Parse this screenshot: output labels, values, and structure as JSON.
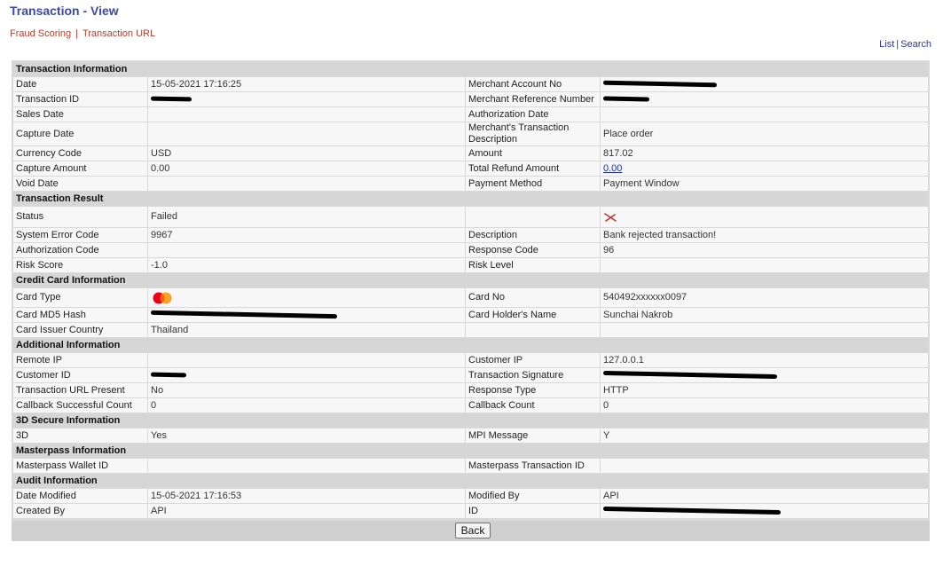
{
  "page": {
    "title": "Transaction - View"
  },
  "nav": {
    "fraud_scoring": "Fraud Scoring",
    "separator": "|",
    "transaction_url": "Transaction URL"
  },
  "right_nav": {
    "list": "List",
    "separator": "|",
    "search": "Search"
  },
  "sections": {
    "transaction_information": {
      "title": "Transaction Information",
      "date_label": "Date",
      "date": "15-05-2021 17:16:25",
      "merchant_account_no_label": "Merchant Account No",
      "merchant_account_no": "",
      "transaction_id_label": "Transaction ID",
      "transaction_id": "",
      "merchant_reference_number_label": "Merchant Reference Number",
      "merchant_reference_number": "",
      "sales_date_label": "Sales Date",
      "sales_date": "",
      "authorization_date_label": "Authorization Date",
      "authorization_date": "",
      "capture_date_label": "Capture Date",
      "capture_date": "",
      "merchant_transaction_description_label": "Merchant's Transaction Description",
      "merchant_transaction_description": "Place order",
      "currency_code_label": "Currency Code",
      "currency_code": "USD",
      "amount_label": "Amount",
      "amount": "817.02",
      "capture_amount_label": "Capture Amount",
      "capture_amount": "0.00",
      "total_refund_amount_label": "Total Refund Amount",
      "total_refund_amount": "0.00",
      "void_date_label": "Void Date",
      "void_date": "",
      "payment_method_label": "Payment Method",
      "payment_method": "Payment Window"
    },
    "transaction_result": {
      "title": "Transaction Result",
      "status_label": "Status",
      "status": "Failed",
      "status_icon": "failed-x-icon",
      "system_error_code_label": "System Error Code",
      "system_error_code": "9967",
      "description_label": "Description",
      "description": "Bank rejected transaction!",
      "authorization_code_label": "Authorization Code",
      "authorization_code": "",
      "response_code_label": "Response Code",
      "response_code": "96",
      "risk_score_label": "Risk Score",
      "risk_score": "-1.0",
      "risk_level_label": "Risk Level",
      "risk_level": ""
    },
    "credit_card_information": {
      "title": "Credit Card Information",
      "card_type_label": "Card Type",
      "card_type_icon": "mastercard-icon",
      "card_no_label": "Card No",
      "card_no": "540492xxxxxx0097",
      "card_md5_hash_label": "Card MD5 Hash",
      "card_md5_hash": "",
      "card_holder_name_label": "Card Holder's Name",
      "card_holder_name": "Sunchai Nakrob",
      "card_issuer_country_label": "Card Issuer Country",
      "card_issuer_country": "Thailand"
    },
    "additional_information": {
      "title": "Additional Information",
      "remote_ip_label": "Remote IP",
      "remote_ip": "",
      "customer_ip_label": "Customer IP",
      "customer_ip": "127.0.0.1",
      "customer_id_label": "Customer ID",
      "customer_id": "",
      "transaction_signature_label": "Transaction Signature",
      "transaction_signature": "",
      "transaction_url_present_label": "Transaction URL Present",
      "transaction_url_present": "No",
      "response_type_label": "Response Type",
      "response_type": "HTTP",
      "callback_successful_count_label": "Callback Successful Count",
      "callback_successful_count": "0",
      "callback_count_label": "Callback Count",
      "callback_count": "0"
    },
    "secure_3d_information": {
      "title": "3D Secure Information",
      "three_d_label": "3D",
      "three_d": "Yes",
      "mpi_message_label": "MPI Message",
      "mpi_message": "Y"
    },
    "masterpass_information": {
      "title": "Masterpass Information",
      "masterpass_wallet_id_label": "Masterpass Wallet ID",
      "masterpass_wallet_id": "",
      "masterpass_transaction_id_label": "Masterpass Transaction ID",
      "masterpass_transaction_id": ""
    },
    "audit_information": {
      "title": "Audit Information",
      "date_modified_label": "Date Modified",
      "date_modified": "15-05-2021 17:16:53",
      "modified_by_label": "Modified By",
      "modified_by": "API",
      "created_by_label": "Created By",
      "created_by": "API",
      "id_label": "ID",
      "id": ""
    }
  },
  "buttons": {
    "back": "Back"
  },
  "colors": {
    "title": "#3b4aa8",
    "nav_link": "#c0392b",
    "right_link": "#2a35b5",
    "failed_icon": "#c0392b"
  }
}
